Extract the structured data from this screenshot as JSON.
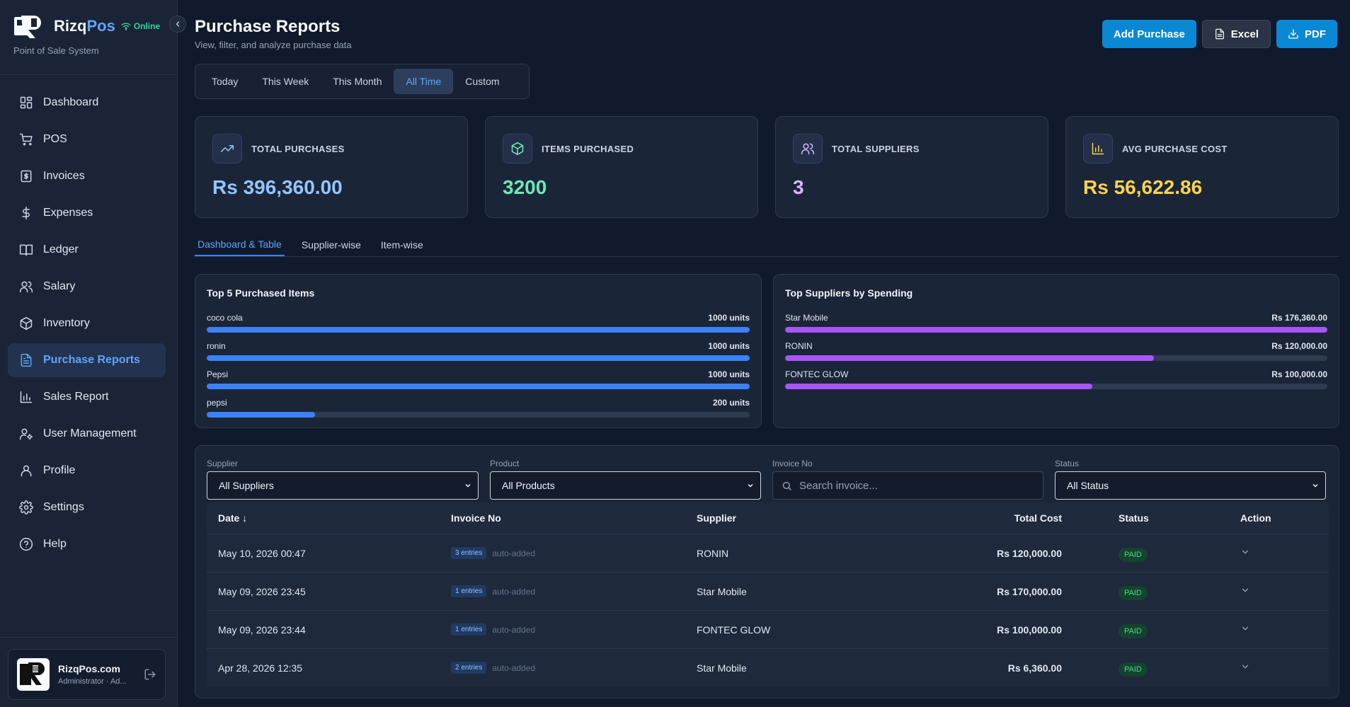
{
  "brand": {
    "name_prefix": "Rizq",
    "name_suffix": "Pos",
    "status": "Online",
    "tagline": "Point of Sale System"
  },
  "nav": [
    {
      "label": "Dashboard",
      "icon": "dashboard-icon"
    },
    {
      "label": "POS",
      "icon": "cart-icon"
    },
    {
      "label": "Invoices",
      "icon": "invoice-icon"
    },
    {
      "label": "Expenses",
      "icon": "dollar-icon"
    },
    {
      "label": "Ledger",
      "icon": "book-icon"
    },
    {
      "label": "Salary",
      "icon": "users-icon"
    },
    {
      "label": "Inventory",
      "icon": "package-icon"
    },
    {
      "label": "Purchase Reports",
      "icon": "document-icon",
      "active": true
    },
    {
      "label": "Sales Report",
      "icon": "bar-chart-icon"
    },
    {
      "label": "User Management",
      "icon": "user-cog-icon"
    },
    {
      "label": "Profile",
      "icon": "user-icon"
    },
    {
      "label": "Settings",
      "icon": "gear-icon"
    },
    {
      "label": "Help",
      "icon": "help-icon"
    }
  ],
  "user": {
    "name": "RizqPos.com",
    "role": "Administrator · Ad..."
  },
  "header": {
    "title": "Purchase Reports",
    "subtitle": "View, filter, and analyze purchase data"
  },
  "actions": {
    "add": "Add Purchase",
    "excel": "Excel",
    "pdf": "PDF"
  },
  "range_tabs": [
    "Today",
    "This Week",
    "This Month",
    "All Time",
    "Custom"
  ],
  "range_active": "All Time",
  "stats": [
    {
      "label": "TOTAL PURCHASES",
      "value": "Rs 396,360.00",
      "color": "#93c5fd",
      "icon": "trend-up-icon",
      "icon_color": "#93c5fd"
    },
    {
      "label": "ITEMS PURCHASED",
      "value": "3200",
      "color": "#6ee7b7",
      "icon": "box-icon",
      "icon_color": "#6ee7b7"
    },
    {
      "label": "TOTAL SUPPLIERS",
      "value": "3",
      "color": "#d8b4fe",
      "icon": "users-icon",
      "icon_color": "#d8b4fe"
    },
    {
      "label": "AVG PURCHASE COST",
      "value": "Rs 56,622.86",
      "color": "#fcd34d",
      "icon": "bar-chart-icon",
      "icon_color": "#fcd34d"
    }
  ],
  "view_tabs": [
    "Dashboard & Table",
    "Supplier-wise",
    "Item-wise"
  ],
  "top_items": {
    "title": "Top 5 Purchased Items",
    "color": "#3b82f6",
    "rows": [
      {
        "label": "coco cola",
        "value": "1000 units",
        "fraction": 1.0
      },
      {
        "label": "ronin",
        "value": "1000 units",
        "fraction": 1.0
      },
      {
        "label": "Pepsi",
        "value": "1000 units",
        "fraction": 1.0
      },
      {
        "label": "pepsi",
        "value": "200 units",
        "fraction": 0.2
      }
    ]
  },
  "top_suppliers": {
    "title": "Top Suppliers by Spending",
    "color": "#a855f7",
    "rows": [
      {
        "label": "Star Mobile",
        "value": "Rs 176,360.00",
        "fraction": 1.0
      },
      {
        "label": "RONIN",
        "value": "Rs 120,000.00",
        "fraction": 0.68
      },
      {
        "label": "FONTEC GLOW",
        "value": "Rs 100,000.00",
        "fraction": 0.567
      }
    ]
  },
  "filters": {
    "supplier_label": "Supplier",
    "supplier_value": "All Suppliers",
    "product_label": "Product",
    "product_value": "All Products",
    "invoice_label": "Invoice No",
    "invoice_placeholder": "Search invoice...",
    "status_label": "Status",
    "status_value": "All Status"
  },
  "table": {
    "headers": {
      "date": "Date ↓",
      "invoice": "Invoice No",
      "supplier": "Supplier",
      "cost": "Total Cost",
      "status": "Status",
      "action": "Action"
    },
    "rows": [
      {
        "date": "May 10, 2026 00:47",
        "entries": "3 entries",
        "note": "auto-added",
        "supplier": "RONIN",
        "cost": "Rs 120,000.00",
        "status": "PAID"
      },
      {
        "date": "May 09, 2026 23:45",
        "entries": "1 entries",
        "note": "auto-added",
        "supplier": "Star Mobile",
        "cost": "Rs 170,000.00",
        "status": "PAID"
      },
      {
        "date": "May 09, 2026 23:44",
        "entries": "1 entries",
        "note": "auto-added",
        "supplier": "FONTEC GLOW",
        "cost": "Rs 100,000.00",
        "status": "PAID"
      },
      {
        "date": "Apr 28, 2026 12:35",
        "entries": "2 entries",
        "note": "auto-added",
        "supplier": "Star Mobile",
        "cost": "Rs 6,360.00",
        "status": "PAID"
      }
    ]
  }
}
